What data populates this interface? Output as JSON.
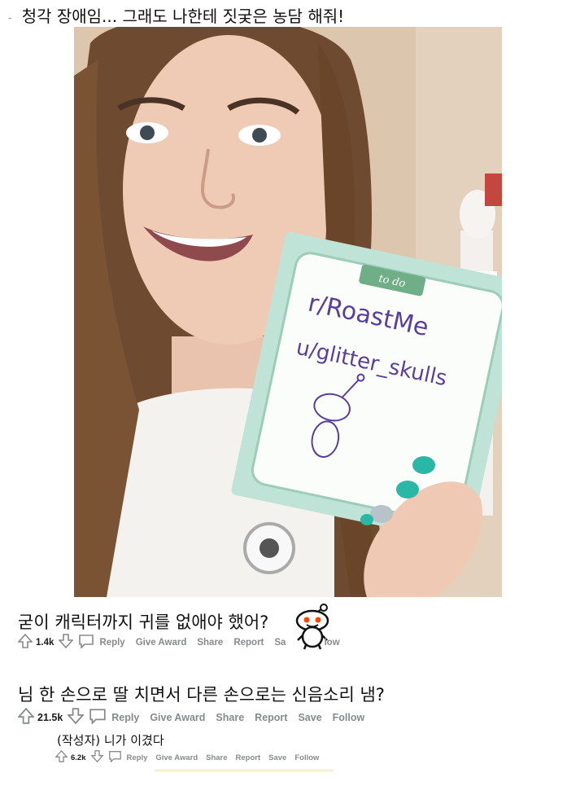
{
  "post": {
    "marker": "-",
    "title": "청각 장애임... 그래도 나한테 짓궂은 농담 해줘!"
  },
  "photo": {
    "card_header": "to do",
    "card_line1": "r/RoastMe",
    "card_line2": "u/glitter_skulls"
  },
  "comments": [
    {
      "text": "굳이 캐릭터까지 귀를 없애야 했어?",
      "votes": "1.4k",
      "actions": [
        "Reply",
        "Give Award",
        "Share",
        "Report",
        "Sa",
        "low"
      ]
    },
    {
      "text": "님 한 손으로 딸 치면서 다른 손으로는 신음소리 냄?",
      "votes": "21.5k",
      "actions": [
        "Reply",
        "Give Award",
        "Share",
        "Report",
        "Save",
        "Follow"
      ]
    },
    {
      "text": "(작성자) 니가 이겼다",
      "votes": "6.2k",
      "actions": [
        "Reply",
        "Give Award",
        "Share",
        "Report",
        "Save",
        "Follow"
      ]
    }
  ],
  "icons": [
    "upvote-icon",
    "downvote-icon",
    "comment-icon",
    "snoo-sticker-icon"
  ],
  "colors": {
    "action_gray": "#878a8c",
    "count_dark": "#1a1a1b",
    "nail_teal": "#2bb7a6",
    "card_mint": "#bfe3d6",
    "pen_purple": "#5a3e9e"
  }
}
